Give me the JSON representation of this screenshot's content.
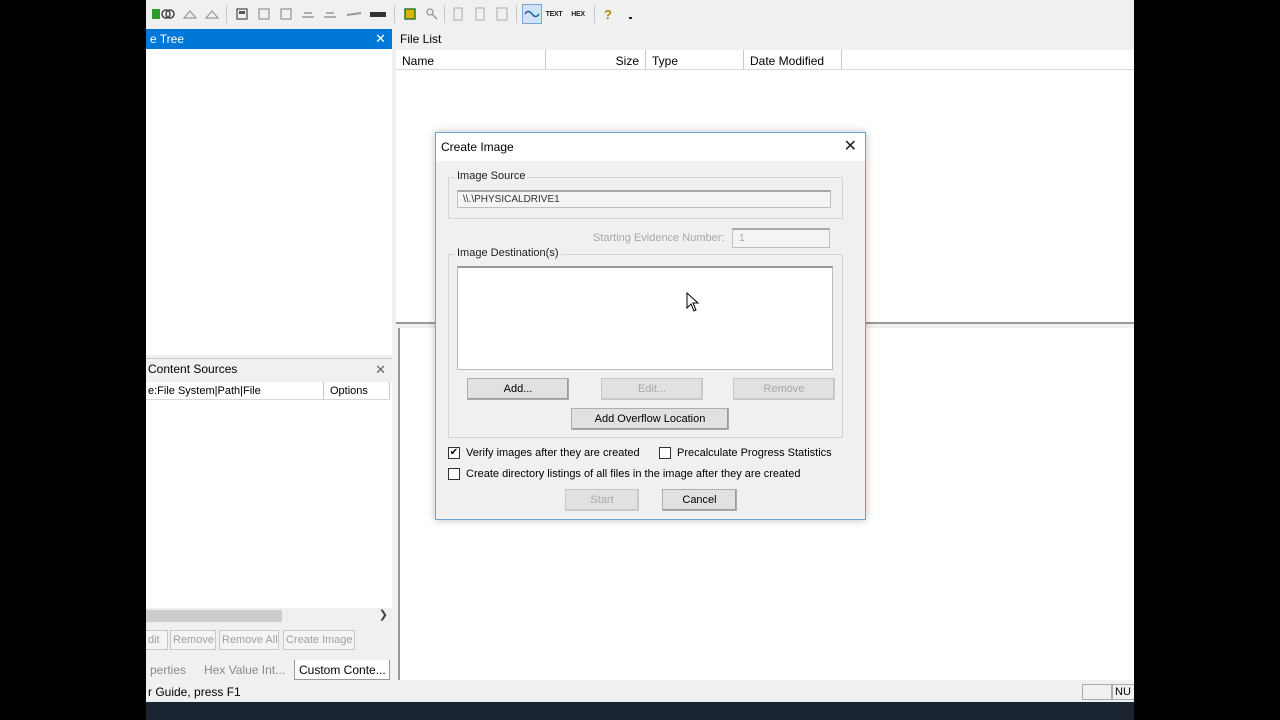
{
  "toolbar": {
    "text_view_label": "TEXT",
    "hex_view_label": "HEX"
  },
  "evidence_tree": {
    "title": "e Tree"
  },
  "file_list": {
    "title": "File List",
    "columns": [
      "Name",
      "Size",
      "Type",
      "Date Modified"
    ]
  },
  "content_sources": {
    "title": "Content Sources",
    "columns": [
      "e:File System|Path|File",
      "Options"
    ],
    "buttons": [
      "dit",
      "Remove",
      "Remove All",
      "Create Image"
    ]
  },
  "bottom_tabs": [
    "perties",
    "Hex Value Int...",
    "Custom Conte..."
  ],
  "status": {
    "text": "r Guide, press F1",
    "indicator": "NU"
  },
  "dialog": {
    "title": "Create Image",
    "image_source_label": "Image Source",
    "image_source_value": "\\\\.\\PHYSICALDRIVE1",
    "starting_evidence_label": "Starting Evidence Number:",
    "starting_evidence_value": "1",
    "image_destinations_label": "Image Destination(s)",
    "add_button": "Add...",
    "edit_button": "Edit...",
    "remove_button": "Remove",
    "overflow_button": "Add Overflow Location",
    "verify_label": "Verify images after they are created",
    "verify_checked": true,
    "precalc_label": "Precalculate Progress Statistics",
    "precalc_checked": false,
    "dirlist_label": "Create directory listings of all files in the image after they are created",
    "dirlist_checked": false,
    "start_button": "Start",
    "cancel_button": "Cancel"
  },
  "colors": {
    "active_title": "#0078d7",
    "dialog_border": "#6fa3d6",
    "window_bg": "#f0f0f0"
  }
}
